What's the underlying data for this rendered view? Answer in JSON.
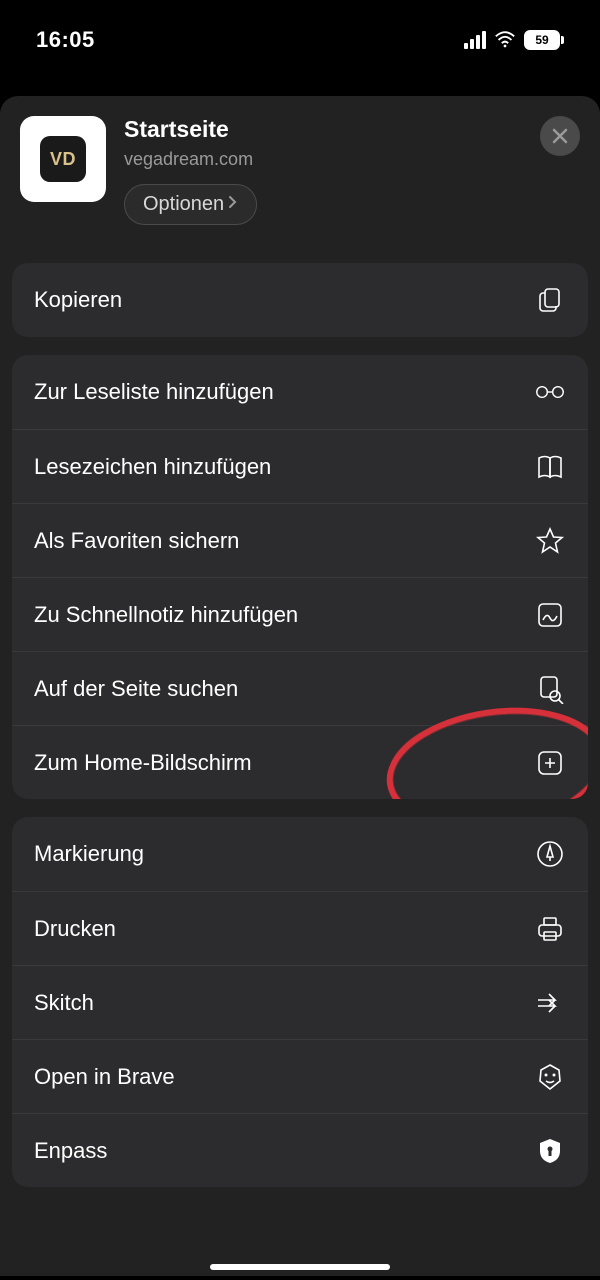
{
  "status": {
    "time": "16:05",
    "battery": "59"
  },
  "header": {
    "title": "Startseite",
    "url": "vegadream.com",
    "options_label": "Optionen",
    "icon_letters": {
      "a": "V",
      "b": "D"
    }
  },
  "groups": [
    {
      "items": [
        {
          "label": "Kopieren",
          "icon": "copy-icon"
        }
      ]
    },
    {
      "items": [
        {
          "label": "Zur Leseliste hinzufügen",
          "icon": "glasses-icon"
        },
        {
          "label": "Lesezeichen hinzufügen",
          "icon": "book-icon"
        },
        {
          "label": "Als Favoriten sichern",
          "icon": "star-icon"
        },
        {
          "label": "Zu Schnellnotiz hinzufügen",
          "icon": "quicknote-icon"
        },
        {
          "label": "Auf der Seite suchen",
          "icon": "doc-search-icon"
        },
        {
          "label": "Zum Home-Bildschirm",
          "icon": "plus-square-icon",
          "annotated": true
        }
      ]
    },
    {
      "items": [
        {
          "label": "Markierung",
          "icon": "markup-icon"
        },
        {
          "label": "Drucken",
          "icon": "printer-icon"
        },
        {
          "label": "Skitch",
          "icon": "skitch-icon"
        },
        {
          "label": "Open in Brave",
          "icon": "brave-icon"
        },
        {
          "label": "Enpass",
          "icon": "enpass-icon"
        }
      ]
    }
  ]
}
